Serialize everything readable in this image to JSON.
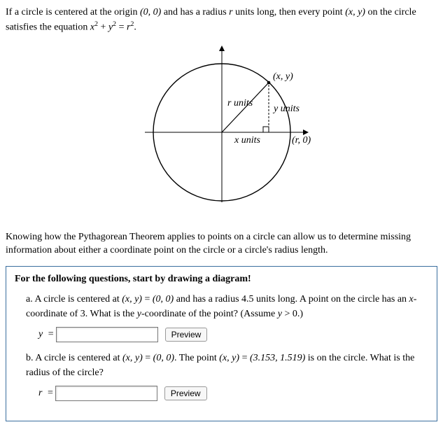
{
  "intro_html": "If a circle is centered at the origin <span class='math-var'>(0, 0)</span> and has a radius <span class='math-var'>r</span> units long, then every point <span class='math-var'>(x, y)</span> on the circle satisfies the equation <span class='math-var'>x</span><sup>2</sup> + <span class='math-var'>y</span><sup>2</sup> = <span class='math-var'>r</span><sup>2</sup>.",
  "diagram": {
    "r_label": "r units",
    "x_label": "x units",
    "y_label": "y units",
    "point_xy": "(x, y)",
    "point_r0": "(r, 0)"
  },
  "knowing": "Knowing how the Pythagorean Theorem applies to points on a circle can allow us to determine missing information about either a coordinate point on the circle or a circle's radius length.",
  "qhead": "For the following questions, start by drawing a diagram!",
  "qa_html": "a. A circle is centered at <span class='math-var'>(x, y)</span> = <span class='math-var'>(0, 0)</span> and has a radius 4.5 units long. A point on the circle has an <span class='math-var'>x</span>-coordinate of 3. What is the <span class='math-var'>y</span>-coordinate of the point? (Assume <span class='math-var'>y</span> &gt; 0.)",
  "qa_var": "y",
  "qa_eq": "=",
  "qa_preview": "Preview",
  "qb_html": "b. A circle is centered at <span class='math-var'>(x, y)</span> = <span class='math-var'>(0, 0)</span>. The point <span class='math-var'>(x, y)</span> = <span class='math-var'>(3.153, 1.519)</span> is on the circle. What is the radius of the circle?",
  "qb_var": "r",
  "qb_eq": "=",
  "qb_preview": "Preview",
  "chart_data": {
    "type": "diagram",
    "description": "Circle centered at origin with radius r. A point (x,y) on the circle in the first quadrant forms a right triangle with horizontal leg x units, vertical leg y units, hypotenuse r units. Point (r,0) marked on positive x-axis.",
    "center": [
      0,
      0
    ],
    "radius_label": "r",
    "points": [
      {
        "label": "(x, y)",
        "quadrant": 1
      },
      {
        "label": "(r, 0)",
        "on_axis": "x"
      }
    ],
    "triangle_legs": {
      "horizontal": "x units",
      "vertical": "y units",
      "hypotenuse": "r units"
    }
  }
}
